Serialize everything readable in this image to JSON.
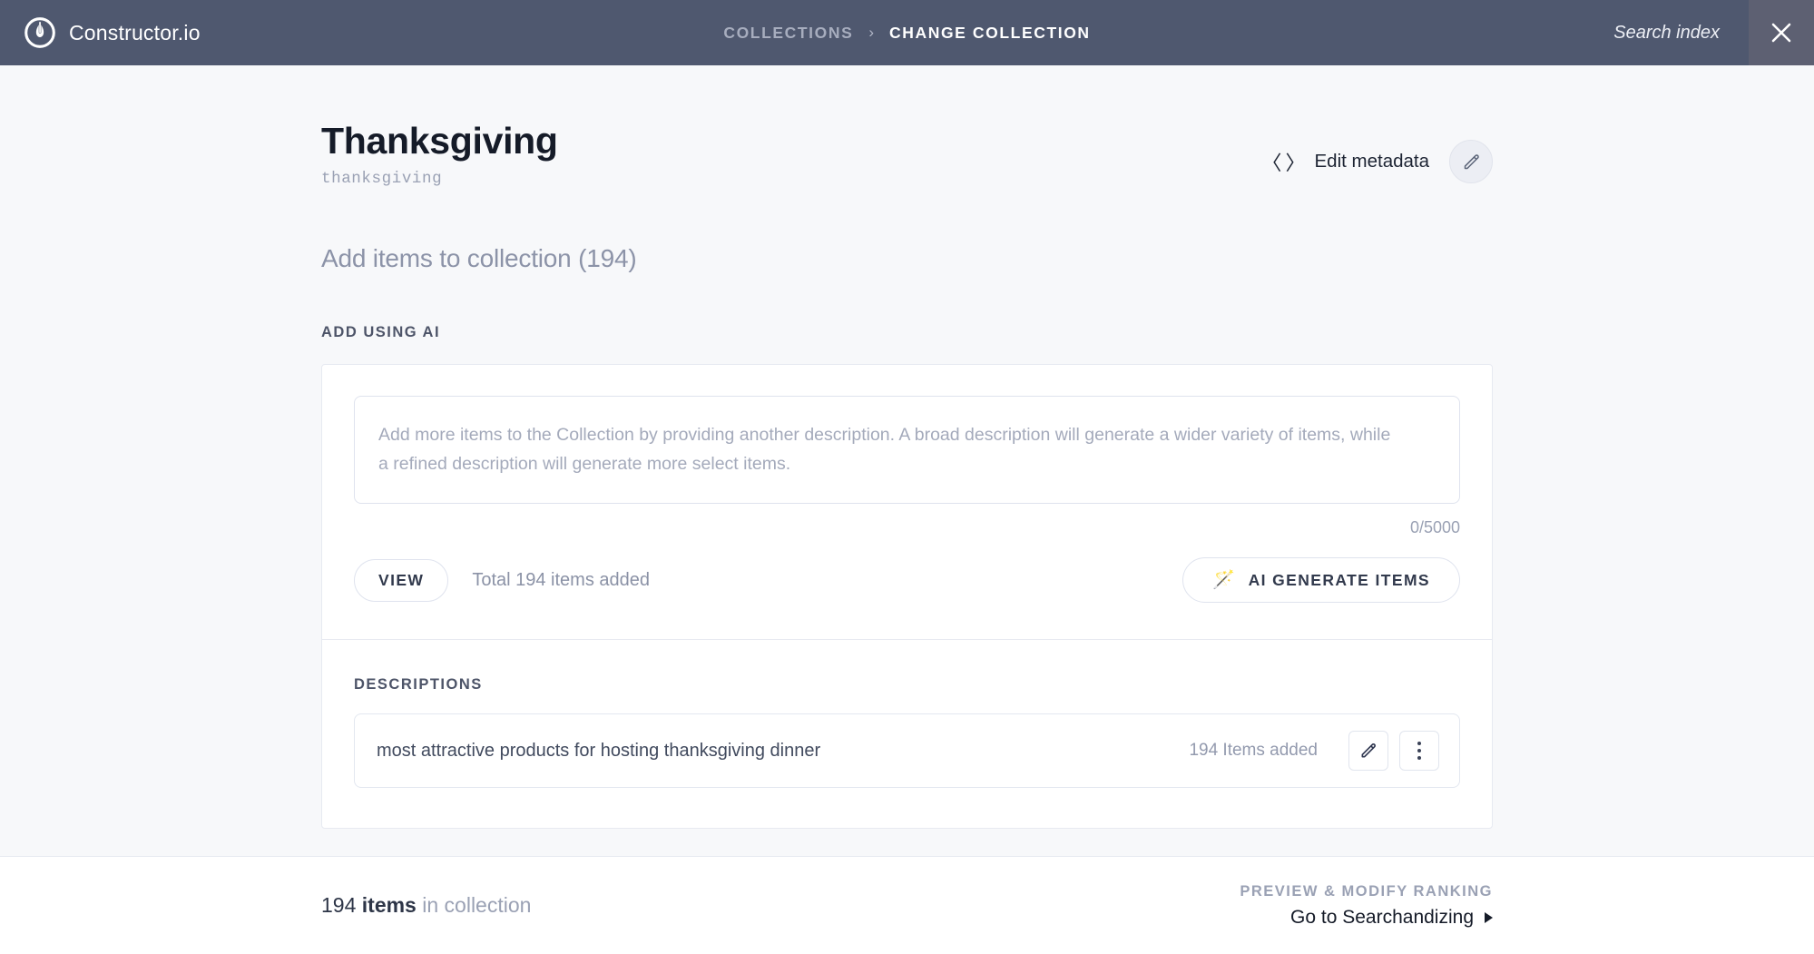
{
  "topbar": {
    "brand": "Constructor.io",
    "logo_icon": "power-flame-logo-icon",
    "breadcrumb": {
      "parent": "COLLECTIONS",
      "separator": "›",
      "current": "CHANGE COLLECTION"
    },
    "search_index_label": "Search index",
    "close_icon": "close-icon",
    "bg_color": "#4f586f",
    "close_bg_color": "#5d6072"
  },
  "header": {
    "title": "Thanksgiving",
    "slug": "thanksgiving",
    "edit_metadata_label": "Edit metadata",
    "code_icon": "〈 〉",
    "edit_icon": "pencil-icon"
  },
  "main": {
    "add_items_heading": "Add items to collection (194)",
    "ai_section_label": "ADD USING AI",
    "textarea": {
      "value": "",
      "placeholder": "Add more items to the Collection by providing another description. A broad description will generate a wider variety of items, while a refined description will generate more select items.",
      "counter": "0/5000",
      "max_length": 5000
    },
    "view_button_label": "VIEW",
    "total_items_added": "Total 194 items added",
    "ai_generate_button_label": "AI GENERATE ITEMS",
    "ai_generate_icon": "magic-wand-icon",
    "descriptions_section_label": "DESCRIPTIONS",
    "descriptions": [
      {
        "text": "most attractive products for hosting thanksgiving dinner",
        "items_added": "194 Items added",
        "edit_icon": "pencil-icon",
        "more_icon": "vertical-dots-icon"
      }
    ]
  },
  "footer": {
    "count": "194",
    "items_word": "items",
    "in_collection": "in collection",
    "preview_label": "PREVIEW & MODIFY RANKING",
    "searchandizing_link": "Go to Searchandizing",
    "arrow_icon": "triangle-right-icon"
  }
}
